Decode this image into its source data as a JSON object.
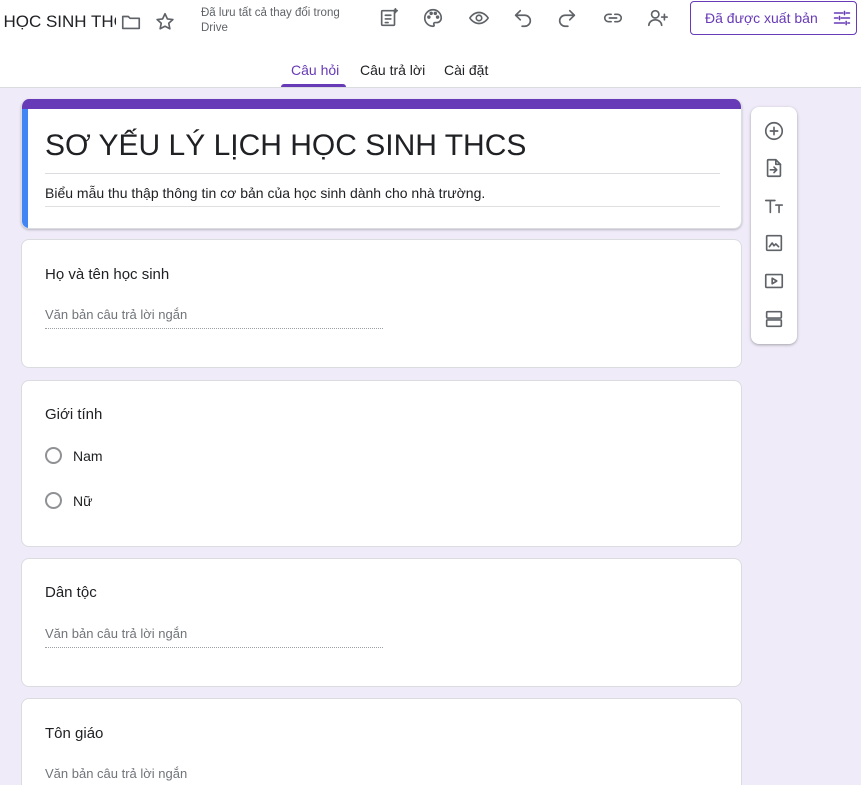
{
  "header": {
    "doc_title": "I HỌC SINH THCS",
    "save_status": "Đã lưu tất cả thay đổi trong Drive",
    "publish_label": "Đã được xuất bản"
  },
  "tabs": [
    {
      "label": "Câu hỏi",
      "active": true
    },
    {
      "label": "Câu trả lời",
      "active": false
    },
    {
      "label": "Cài đặt",
      "active": false
    }
  ],
  "form": {
    "title": "SƠ YẾU LÝ LỊCH HỌC SINH THCS",
    "description": "Biểu mẫu thu thập thông tin cơ bản của học sinh dành cho nhà trường."
  },
  "questions": [
    {
      "title": "Họ và tên học sinh",
      "placeholder": "Văn bản câu trả lời ngắn"
    },
    {
      "title": "Giới tính",
      "options": [
        "Nam",
        "Nữ"
      ]
    },
    {
      "title": "Dân tộc",
      "placeholder": "Văn bản câu trả lời ngắn"
    },
    {
      "title": "Tôn giáo",
      "placeholder": "Văn bản câu trả lời ngắn"
    }
  ],
  "colors": {
    "accent": "#673ab7",
    "background": "#f0ebf8",
    "title_left_bar": "#4285f4"
  },
  "icons": {
    "header": [
      "folder-icon",
      "star-icon",
      "ai-form-icon",
      "palette-icon",
      "preview-eye-icon",
      "undo-icon",
      "redo-icon",
      "link-icon",
      "add-collaborator-icon",
      "tune-icon"
    ],
    "toolbar": [
      "add-question-icon",
      "import-questions-icon",
      "add-title-icon",
      "add-image-icon",
      "add-video-icon",
      "add-section-icon"
    ]
  }
}
